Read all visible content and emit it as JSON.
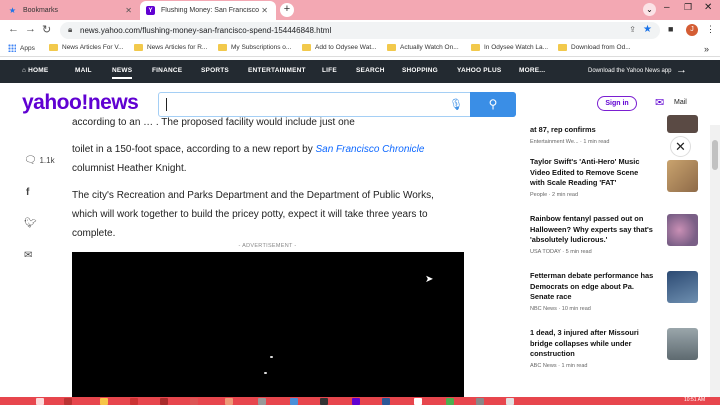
{
  "browser": {
    "tabs": [
      {
        "title": "Bookmarks",
        "active": false
      },
      {
        "title": "Flushing Money: San Francisco",
        "active": true
      }
    ],
    "url": "news.yahoo.com/flushing-money-san-francisco-spend-154446848.html",
    "profile_initial": "J",
    "bookmarks": [
      {
        "label": "Apps",
        "type": "apps"
      },
      {
        "label": "News Articles For V...",
        "type": "folder"
      },
      {
        "label": "News Articles for R...",
        "type": "folder"
      },
      {
        "label": "My Subscriptions o...",
        "type": "folder"
      },
      {
        "label": "Add to Odysee Wat...",
        "type": "folder"
      },
      {
        "label": "Actually Watch On...",
        "type": "folder"
      },
      {
        "label": "In Odysee Watch La...",
        "type": "folder"
      },
      {
        "label": "Download from Od...",
        "type": "folder"
      }
    ]
  },
  "yahoo_nav": {
    "items": [
      "HOME",
      "MAIL",
      "NEWS",
      "FINANCE",
      "SPORTS",
      "ENTERTAINMENT",
      "LIFE",
      "SEARCH",
      "SHOPPING",
      "YAHOO PLUS",
      "MORE..."
    ],
    "active": "NEWS",
    "promo": "Download the Yahoo News app"
  },
  "header": {
    "logo": "yahoo!news",
    "search_placeholder": "",
    "signin": "Sign in",
    "mail": "Mail"
  },
  "article": {
    "partial_line": "according to an … . The proposed facility would include just one",
    "p1_before": "toilet in a 150-foot space, according to a new report by ",
    "p1_link": "San Francisco Chronicle",
    "p1_after": " columnist Heather Knight.",
    "p2": "The city's Recreation and Parks Department and the Department of Public Works, which will work together to build the pricey potty, expect it will take three years to complete.",
    "ad_label": "- ADVERTISEMENT -"
  },
  "share": {
    "comment_count": "1.1k",
    "comment_icon": "speech-bubble-icon",
    "icons": [
      "facebook-icon",
      "twitter-icon",
      "email-icon"
    ]
  },
  "sidebar": {
    "stories": [
      {
        "headline": "at 87, rep confirms",
        "meta": "Entertainment We... · 1 min read",
        "thumb_color": "#5a4a44"
      },
      {
        "headline": "Taylor Swift's 'Anti-Hero' Music Video Edited to Remove Scene with Scale Reading 'FAT'",
        "meta": "People · 2 min read",
        "thumb_color": "#a8845e"
      },
      {
        "headline": "Rainbow fentanyl passed out on Halloween? Why experts say that's 'absolutely ludicrous.'",
        "meta": "USA TODAY · 5 min read",
        "thumb_color": "#8a6a8e"
      },
      {
        "headline": "Fetterman debate performance has Democrats on edge about Pa. Senate race",
        "meta": "NBC News · 10 min read",
        "thumb_color": "#3f5a7a"
      },
      {
        "headline": "1 dead, 3 injured after Missouri bridge collapses while under construction",
        "meta": "ABC News · 1 min read",
        "thumb_color": "#7d8a90"
      }
    ]
  },
  "taskbar": {
    "time": "10:51 AM"
  }
}
